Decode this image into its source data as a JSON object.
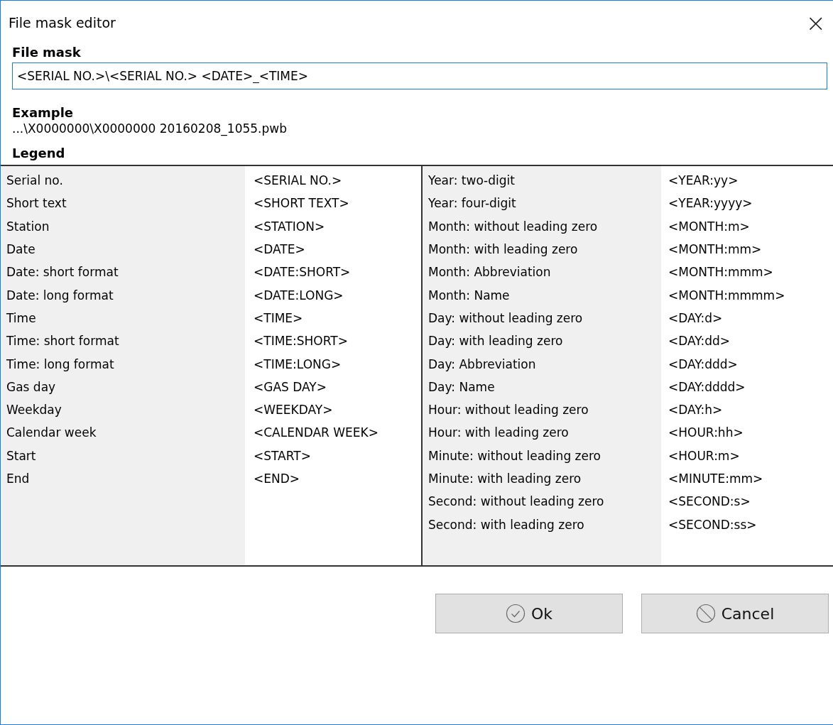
{
  "window": {
    "title": "File mask editor",
    "close": "×"
  },
  "file_mask": {
    "label": "File mask",
    "value": "<SERIAL NO.>\\<SERIAL NO.> <DATE>_<TIME>"
  },
  "example": {
    "label": "Example",
    "text": "...\\X0000000\\X0000000 20160208_1055.pwb"
  },
  "legend": {
    "label": "Legend",
    "groups": [
      [
        {
          "name": "Serial no.",
          "token": "<SERIAL NO.>"
        },
        {
          "name": "Short text",
          "token": "<SHORT TEXT>"
        },
        {
          "name": "Station",
          "token": "<STATION>"
        },
        {
          "name": "Date",
          "token": "<DATE>"
        },
        {
          "name": "Date: short format",
          "token": "<DATE:SHORT>"
        },
        {
          "name": "Date: long format",
          "token": "<DATE:LONG>"
        },
        {
          "name": "Time",
          "token": "<TIME>"
        },
        {
          "name": "Time: short format",
          "token": "<TIME:SHORT>"
        },
        {
          "name": "Time: long format",
          "token": "<TIME:LONG>"
        },
        {
          "name": "Gas day",
          "token": "<GAS DAY>"
        },
        {
          "name": "Weekday",
          "token": "<WEEKDAY>"
        },
        {
          "name": "Calendar week",
          "token": "<CALENDAR WEEK>"
        },
        {
          "name": "Start",
          "token": "<START>"
        },
        {
          "name": "End",
          "token": "<END>"
        }
      ],
      [
        {
          "name": "Year: two-digit",
          "token": "<YEAR:yy>"
        },
        {
          "name": "Year: four-digit",
          "token": "<YEAR:yyyy>"
        },
        {
          "name": "Month: without leading zero",
          "token": "<MONTH:m>"
        },
        {
          "name": "Month: with leading zero",
          "token": "<MONTH:mm>"
        },
        {
          "name": "Month: Abbreviation",
          "token": "<MONTH:mmm>"
        },
        {
          "name": "Month: Name",
          "token": "<MONTH:mmmm>"
        },
        {
          "name": "Day: without leading zero",
          "token": "<DAY:d>"
        },
        {
          "name": "Day: with leading zero",
          "token": "<DAY:dd>"
        },
        {
          "name": "Day: Abbreviation",
          "token": "<DAY:ddd>"
        },
        {
          "name": "Day: Name",
          "token": "<DAY:dddd>"
        },
        {
          "name": "Hour: without leading zero",
          "token": "<DAY:h>"
        },
        {
          "name": "Hour: with leading zero",
          "token": "<HOUR:hh>"
        },
        {
          "name": "Minute: without leading zero",
          "token": "<HOUR:m>"
        },
        {
          "name": "Minute: with leading zero",
          "token": "<MINUTE:mm>"
        },
        {
          "name": "Second: without leading zero",
          "token": "<SECOND:s>"
        },
        {
          "name": "Second: with leading zero",
          "token": "<SECOND:ss>"
        }
      ]
    ]
  },
  "buttons": [
    {
      "label": "Ok",
      "kind": "ok"
    },
    {
      "label": "Cancel",
      "kind": "cancel"
    }
  ]
}
